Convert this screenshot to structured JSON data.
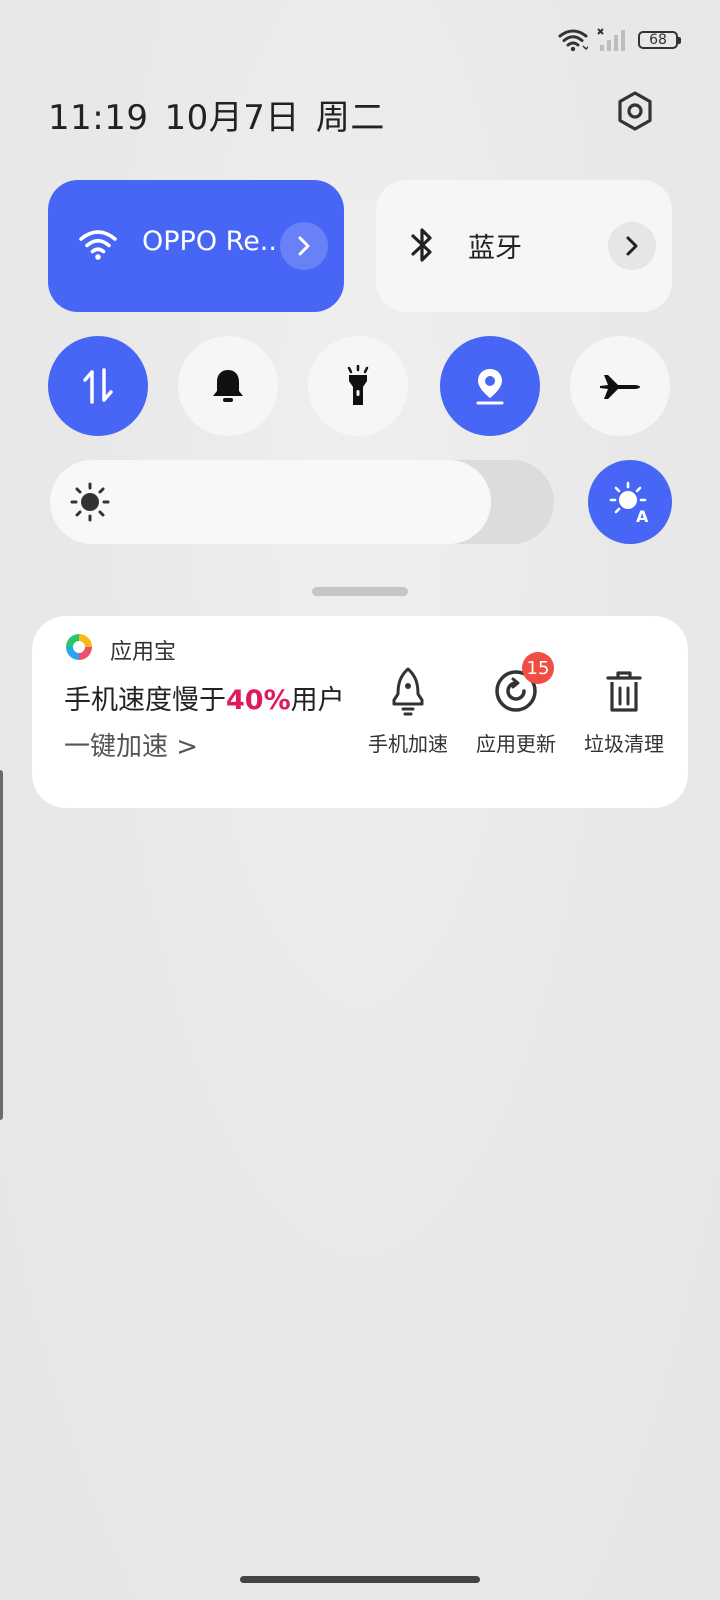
{
  "status_bar": {
    "battery_level": "68",
    "icons": [
      "wifi-icon",
      "cellular-signal-icon",
      "battery-icon"
    ]
  },
  "header": {
    "time": "11:19",
    "date": "10月7日",
    "weekday": "周二",
    "settings_icon": "settings-icon"
  },
  "tiles": {
    "wifi": {
      "label": "OPPO Re..",
      "state": "on",
      "icon": "wifi-icon"
    },
    "bluetooth": {
      "label": "蓝牙",
      "state": "off",
      "icon": "bluetooth-icon"
    }
  },
  "toggles": [
    {
      "name": "mobile-data",
      "icon": "mobile-data-icon",
      "state": "on"
    },
    {
      "name": "sound",
      "icon": "bell-icon",
      "state": "off"
    },
    {
      "name": "flashlight",
      "icon": "flashlight-icon",
      "state": "off"
    },
    {
      "name": "location",
      "icon": "location-icon",
      "state": "on"
    },
    {
      "name": "airplane-mode",
      "icon": "airplane-icon",
      "state": "off"
    }
  ],
  "brightness": {
    "level_fraction": 0.875,
    "auto": true,
    "icons": [
      "sun-icon",
      "auto-brightness-icon"
    ]
  },
  "notification": {
    "app_name": "应用宝",
    "promo_prefix": "手机速度慢于",
    "promo_highlight": "40%",
    "promo_suffix": "用户",
    "link": "一键加速 >",
    "actions": [
      {
        "label": "手机加速",
        "icon": "rocket-icon"
      },
      {
        "label": "应用更新",
        "icon": "update-icon",
        "badge": "15"
      },
      {
        "label": "垃圾清理",
        "icon": "trash-icon"
      }
    ]
  },
  "colors": {
    "accent": "#4866f6",
    "tile_off": "#f6f6f6",
    "highlight": "#e0185f",
    "badge": "#f04d45"
  }
}
